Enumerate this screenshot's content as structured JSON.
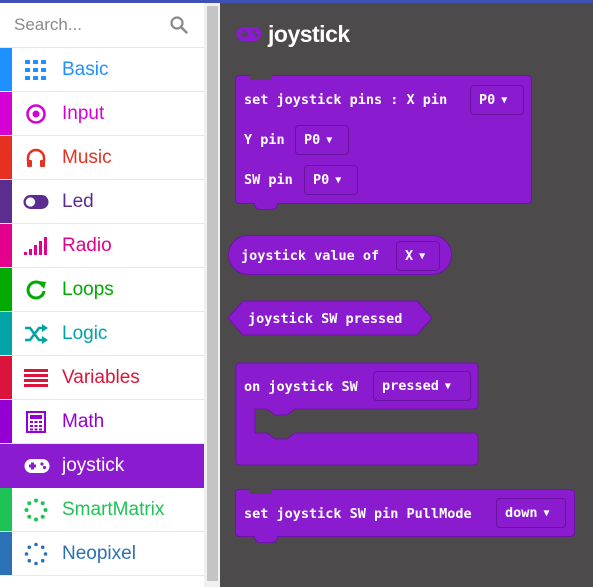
{
  "search": {
    "placeholder": "Search..."
  },
  "categories": [
    {
      "label": "Basic",
      "icon": "grid-icon",
      "color": "#1e90ff"
    },
    {
      "label": "Input",
      "icon": "target-icon",
      "color": "#d400d4"
    },
    {
      "label": "Music",
      "icon": "headphones-icon",
      "color": "#e63022"
    },
    {
      "label": "Led",
      "icon": "toggle-icon",
      "color": "#5c2d91"
    },
    {
      "label": "Radio",
      "icon": "signal-bars-icon",
      "color": "#e3008c"
    },
    {
      "label": "Loops",
      "icon": "refresh-icon",
      "color": "#00aa00"
    },
    {
      "label": "Logic",
      "icon": "shuffle-icon",
      "color": "#00a4a6"
    },
    {
      "label": "Variables",
      "icon": "lines-icon",
      "color": "#dc143c"
    },
    {
      "label": "Math",
      "icon": "calculator-icon",
      "color": "#9400d3"
    },
    {
      "label": "joystick",
      "icon": "gamepad-icon",
      "color": "#8a1bce"
    },
    {
      "label": "SmartMatrix",
      "icon": "dotted-circle-icon",
      "color": "#1ec256"
    },
    {
      "label": "Neopixel",
      "icon": "dotted-circle-icon",
      "color": "#2b71b5"
    }
  ],
  "selected_category": "joystick",
  "flyout": {
    "title": "joystick",
    "blocks": {
      "set_pins": {
        "line1": "set joystick pins : X pin",
        "x_pin": "P0",
        "line2": "Y pin",
        "y_pin": "P0",
        "line3": "SW pin",
        "sw_pin": "P0"
      },
      "value_of": {
        "text": "joystick value of",
        "axis": "X"
      },
      "sw_pressed": {
        "text": "joystick SW pressed"
      },
      "on_sw": {
        "text": "on joystick SW",
        "state": "pressed"
      },
      "pullmode": {
        "text": "set joystick SW pin PullMode",
        "mode": "down"
      }
    }
  },
  "colors": {
    "block": "#8a1bce",
    "workspace": "#4d4a4b",
    "accent": "#3f51b5"
  }
}
